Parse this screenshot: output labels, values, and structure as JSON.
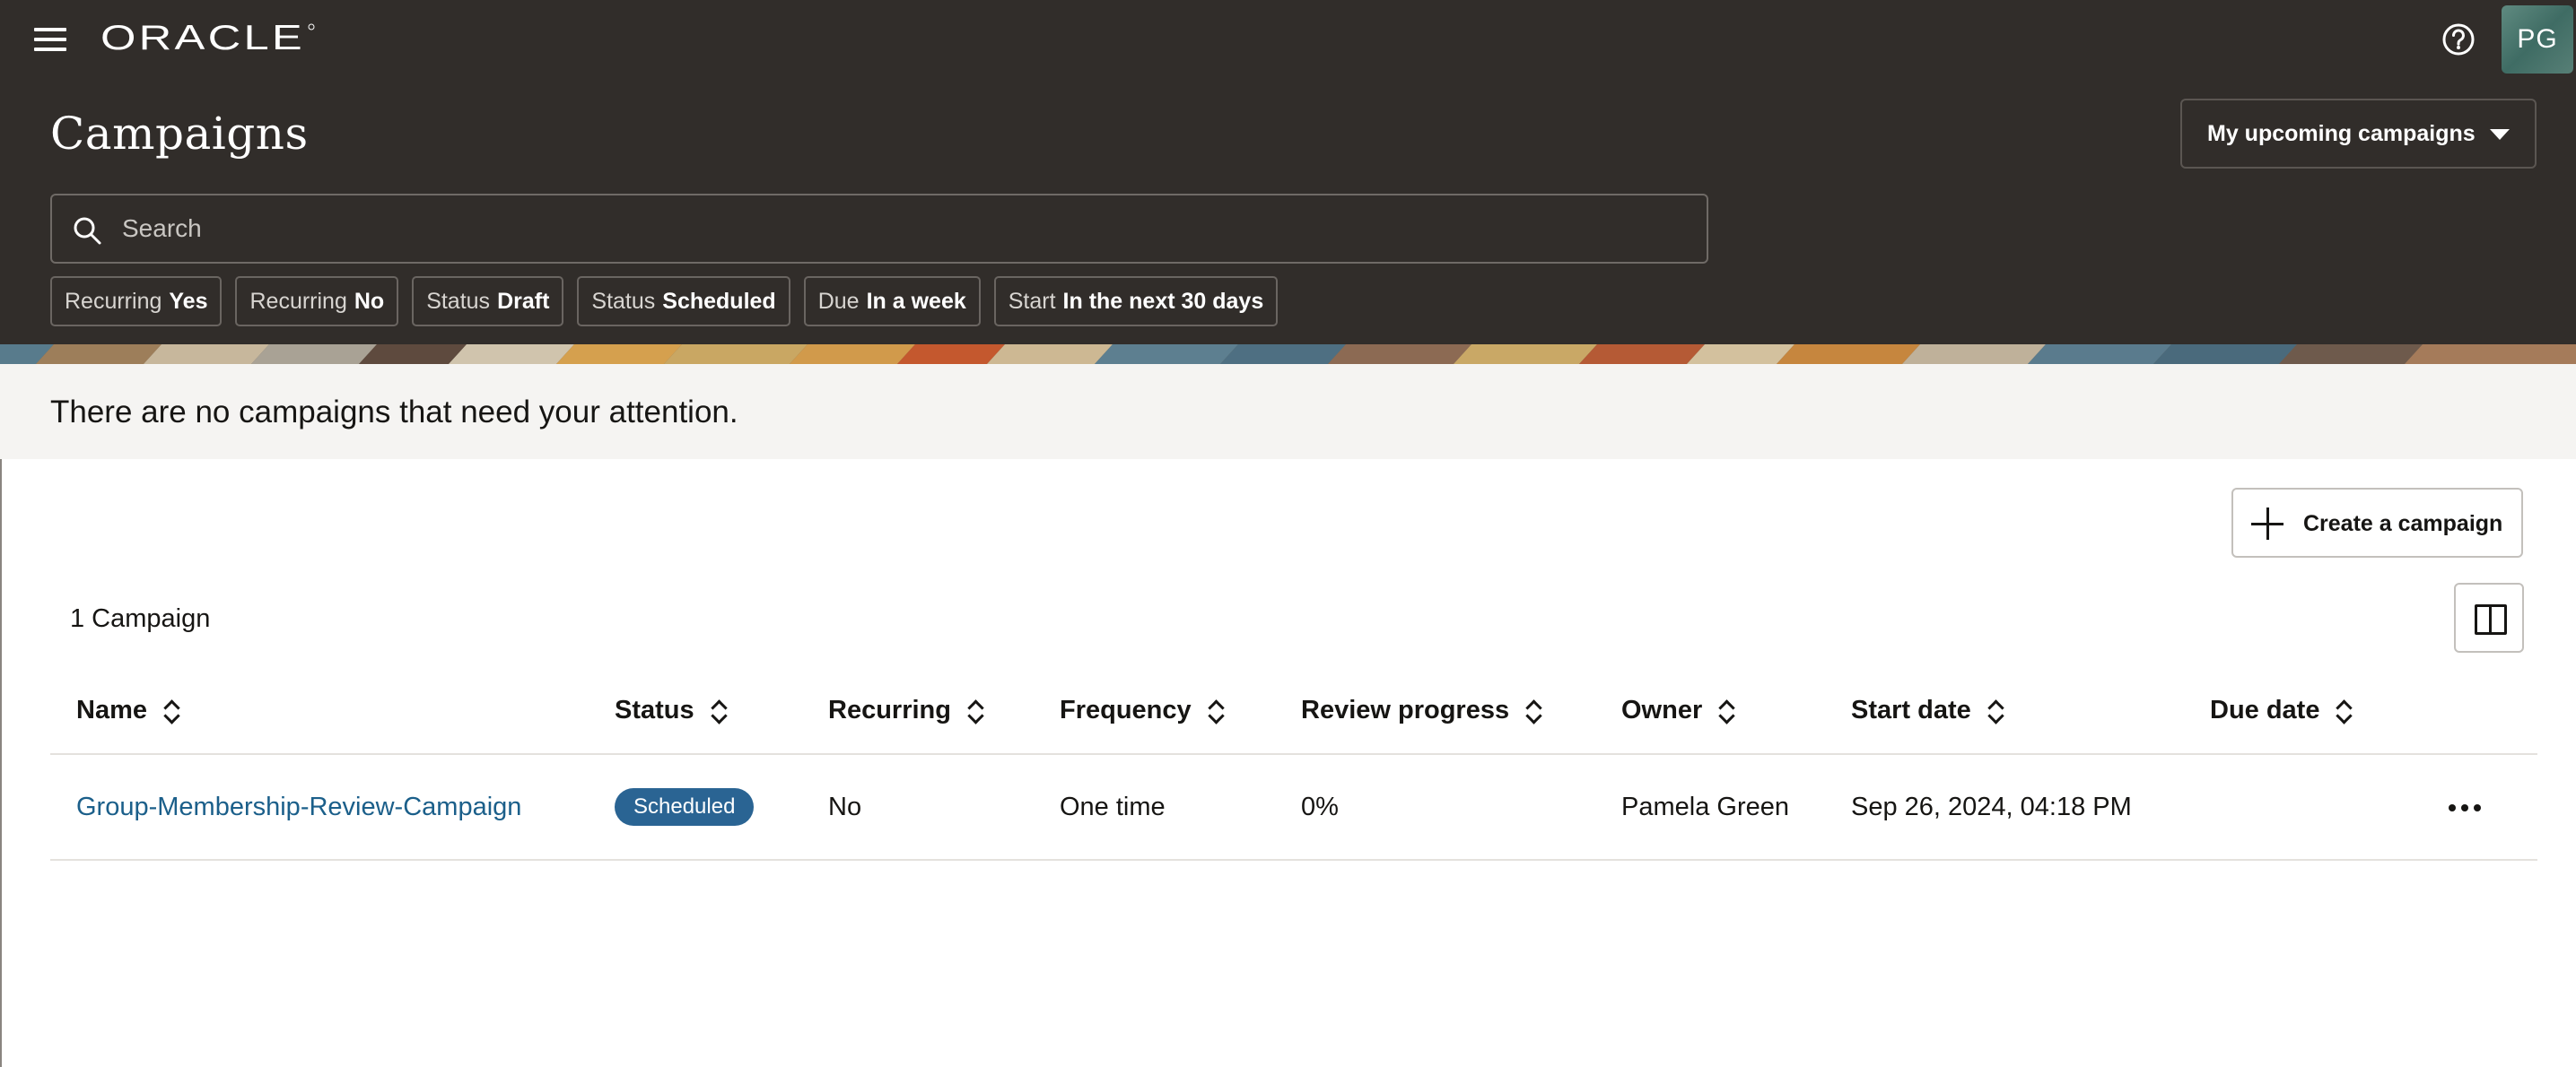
{
  "header": {
    "brand": "ORACLE",
    "title": "Campaigns",
    "user_initials": "PG",
    "view_select": {
      "selected": "My upcoming campaigns"
    },
    "search": {
      "placeholder": "Search",
      "value": ""
    },
    "filter_chips": [
      {
        "key": "Recurring",
        "value": "Yes"
      },
      {
        "key": "Recurring",
        "value": "No"
      },
      {
        "key": "Status",
        "value": "Draft"
      },
      {
        "key": "Status",
        "value": "Scheduled"
      },
      {
        "key": "Due",
        "value": "In a week"
      },
      {
        "key": "Start",
        "value": "In the next 30 days"
      }
    ]
  },
  "attention": {
    "message": "There are no campaigns that need your attention."
  },
  "toolbar": {
    "create_label": "Create a campaign",
    "count_label": "1 Campaign"
  },
  "table": {
    "columns": [
      "Name",
      "Status",
      "Recurring",
      "Frequency",
      "Review progress",
      "Owner",
      "Start date",
      "Due date"
    ],
    "rows": [
      {
        "name": "Group-Membership-Review-Campaign",
        "status": "Scheduled",
        "recurring": "No",
        "frequency": "One time",
        "review_progress": "0%",
        "owner": "Pamela Green",
        "start_date": "Sep 26, 2024, 04:18 PM",
        "due_date": ""
      }
    ]
  },
  "icons": {
    "menu": "hamburger-menu-icon",
    "help": "help-circle-icon",
    "search": "search-icon",
    "add": "plus-icon",
    "columns": "panel-split-icon",
    "more": "more-horizontal-icon",
    "sort": "sort-arrows-icon",
    "dropdown": "chevron-down-icon"
  },
  "colors": {
    "header_bg": "#312d2a",
    "link": "#1b5f8a",
    "badge_scheduled": "#2a6493",
    "attention_bg": "#f5f4f2"
  }
}
